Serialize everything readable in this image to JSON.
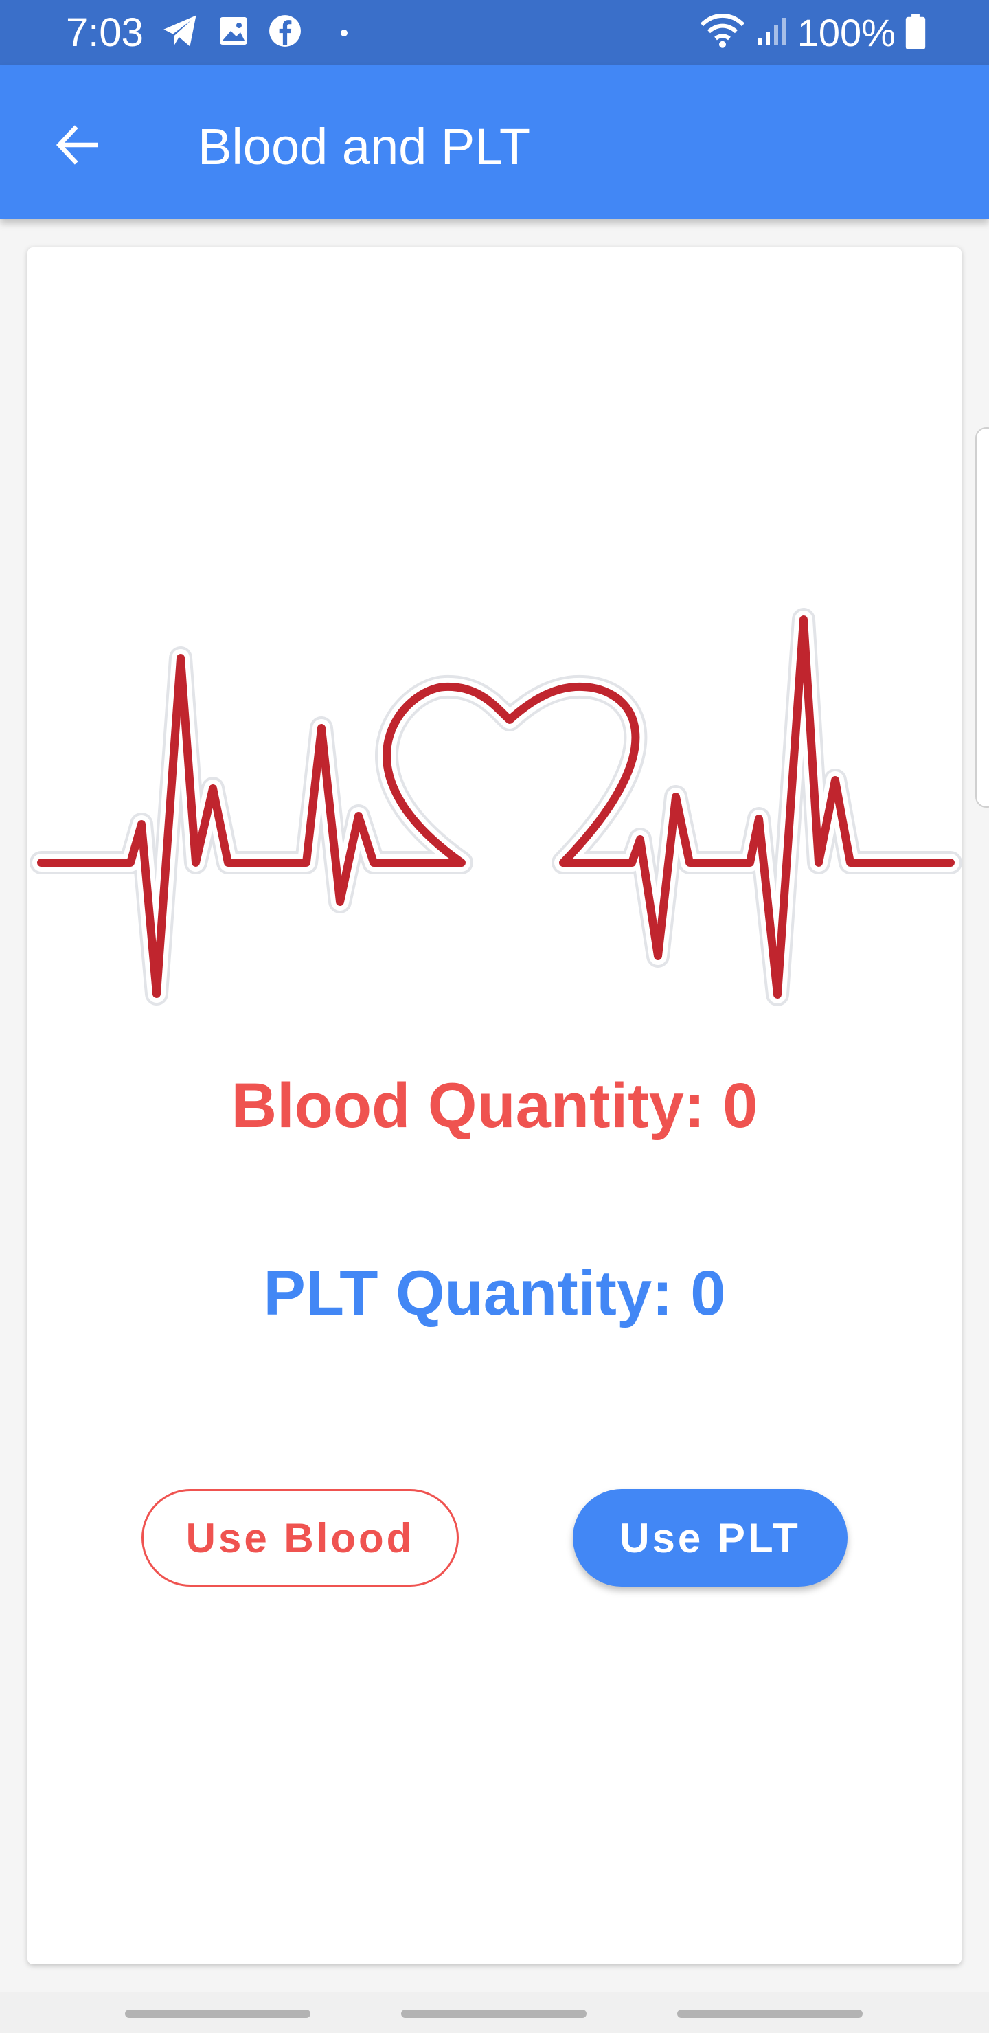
{
  "status_bar": {
    "time": "7:03",
    "battery_text": "100%",
    "left_icons": [
      "telegram-icon",
      "image-icon",
      "facebook-icon",
      "dot-icon"
    ],
    "right_icons": [
      "wifi-icon",
      "signal-icon",
      "battery-icon"
    ]
  },
  "app_bar": {
    "title": "Blood and PLT",
    "back_icon": "arrow-back-icon"
  },
  "content": {
    "illustration": "heartbeat-heart-icon",
    "blood_quantity": "Blood Quantity: 0",
    "plt_quantity": "PLT Quantity: 0"
  },
  "buttons": {
    "use_blood": "Use Blood",
    "use_plt": "Use PLT"
  },
  "colors": {
    "status_bar": "#3a6fc9",
    "app_bar": "#4287f5",
    "blood": "#ef5350",
    "plt": "#4287f5",
    "heartbeat_line": "#c0252e"
  }
}
